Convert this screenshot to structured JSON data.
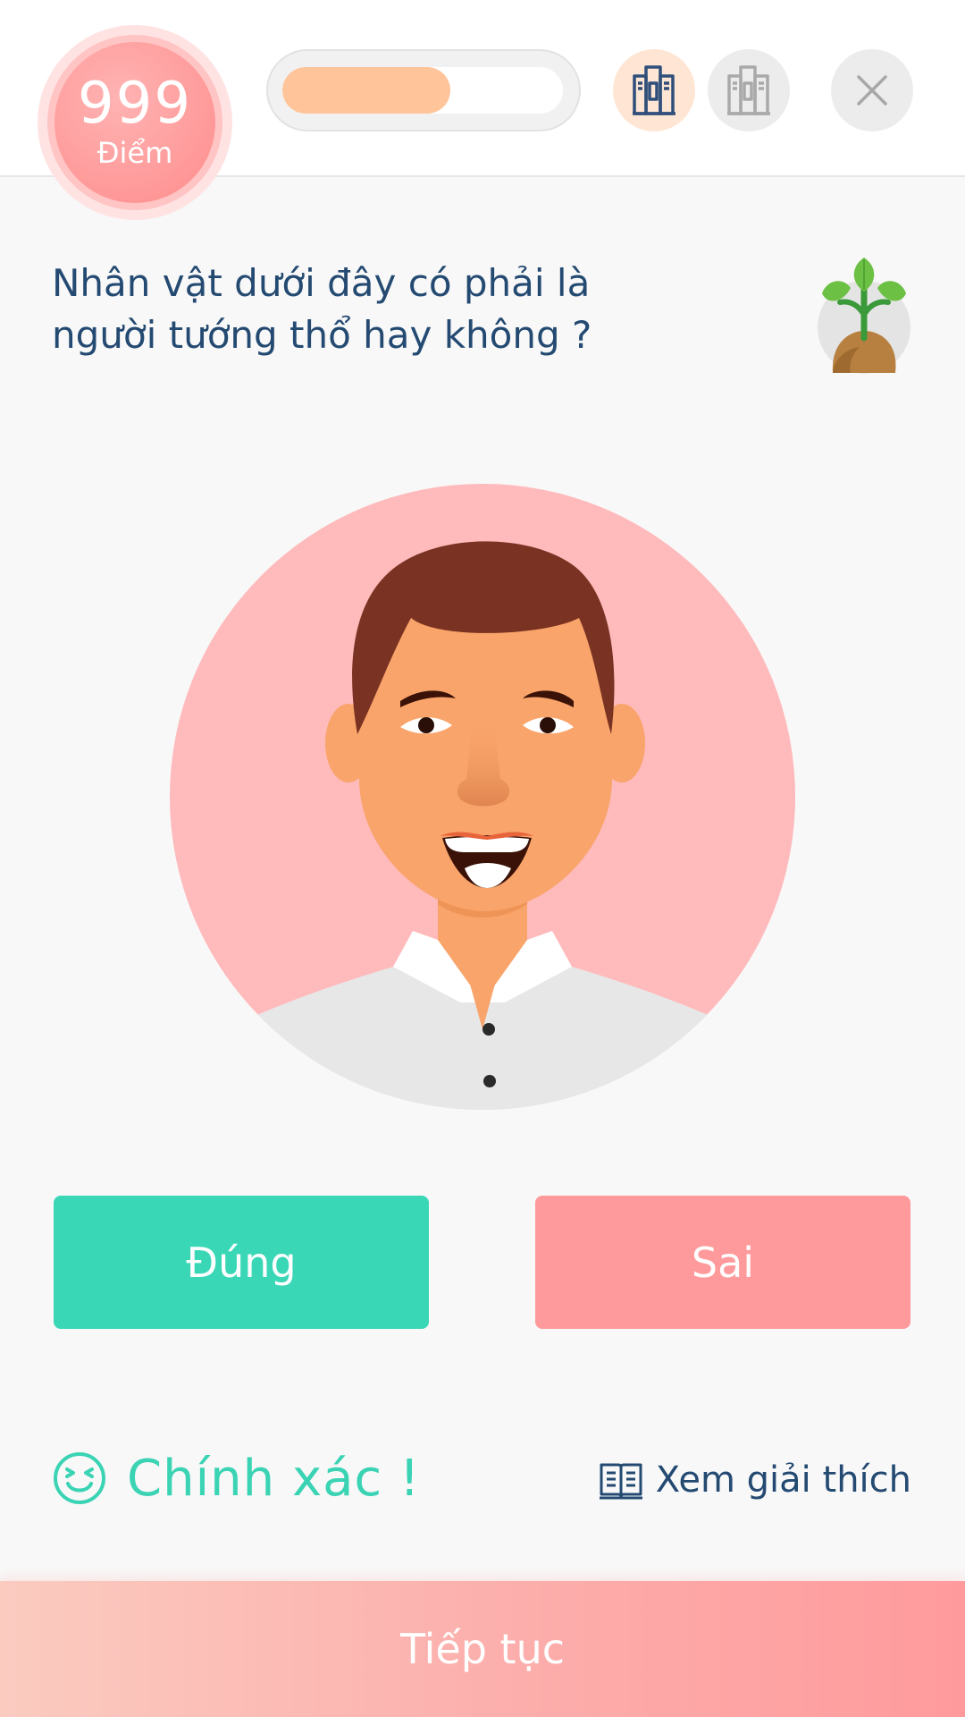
{
  "score": {
    "value": "999",
    "label": "Điểm"
  },
  "progress": {
    "fraction": 0.6
  },
  "header": {
    "icons": [
      "books-icon",
      "books-icon",
      "close-icon"
    ]
  },
  "question": {
    "line1": "Nhân vật dưới đây có phải là",
    "line2": "người tướng thổ hay không ?",
    "badge_icon": "plant-sprout-icon"
  },
  "avatar": {
    "icon": "smiling-man-avatar"
  },
  "answers": {
    "true_label": "Đúng",
    "false_label": "Sai"
  },
  "result": {
    "text": "Chính xác !",
    "icon": "laughing-face-icon"
  },
  "explain": {
    "label": "Xem giải thích",
    "icon": "open-book-icon"
  },
  "continue": {
    "label": "Tiếp tục"
  },
  "colors": {
    "accent_green": "#3ad7b7",
    "accent_pink": "#ff9a9c",
    "text_navy": "#244a72",
    "progress_orange": "#ffc499"
  }
}
